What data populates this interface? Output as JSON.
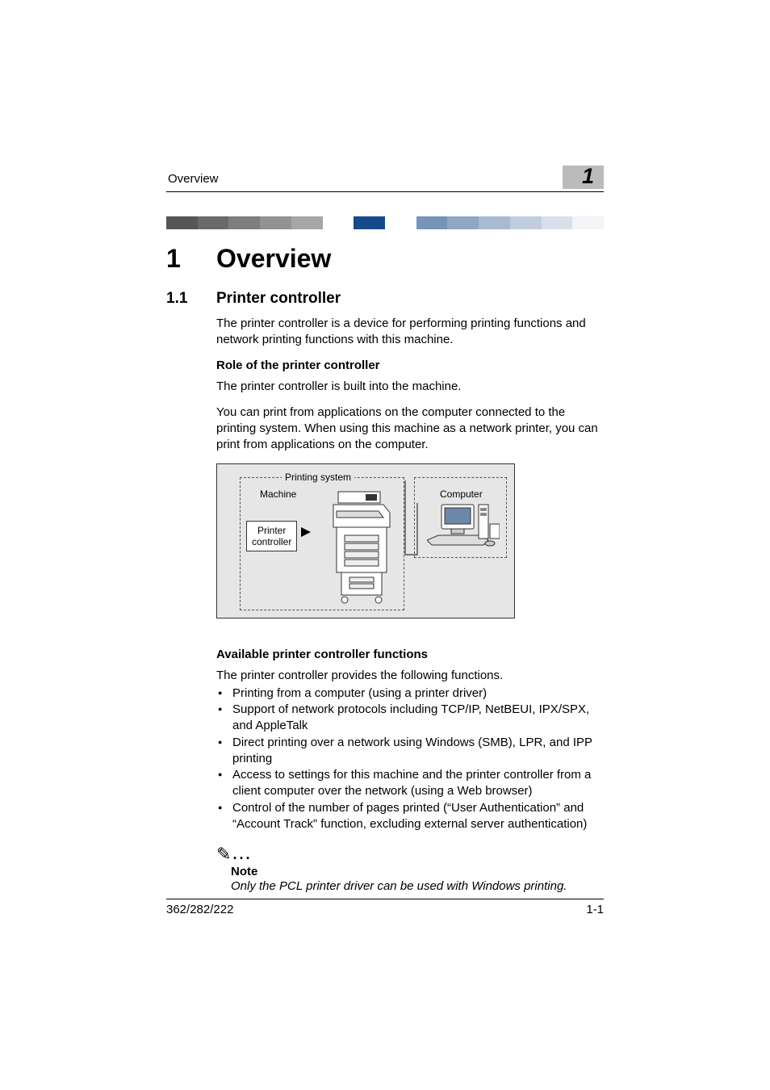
{
  "running_head": {
    "title": "Overview",
    "chapter_mark": "1"
  },
  "chapter": {
    "num": "1",
    "title": "Overview"
  },
  "section": {
    "num": "1.1",
    "title": "Printer controller"
  },
  "intro": "The printer controller is a device for performing printing functions and network printing functions with this machine.",
  "role": {
    "heading": "Role of the printer controller",
    "p1": "The printer controller is built into the machine.",
    "p2": "You can print from applications on the computer connected to the printing system. When using this machine as a network printer, you can print from applications on the computer."
  },
  "figure": {
    "printing_system": "Printing system",
    "machine": "Machine",
    "computer": "Computer",
    "printer_controller_l1": "Printer",
    "printer_controller_l2": "controller"
  },
  "functions": {
    "heading": "Available printer controller functions",
    "intro": "The printer controller provides the following functions.",
    "items": [
      "Printing from a computer (using a printer driver)",
      "Support of network protocols including TCP/IP, NetBEUI, IPX/SPX, and AppleTalk",
      "Direct printing over a network using Windows (SMB), LPR, and IPP printing",
      "Access to settings for this machine and the printer controller from a client computer over the network (using a Web browser)",
      "Control of the number of pages printed (“User Authentication” and “Account Track” function, excluding external server authentication)"
    ]
  },
  "note": {
    "label": "Note",
    "body": "Only the PCL printer driver can be used with Windows printing."
  },
  "footer": {
    "left": "362/282/222",
    "right": "1-1"
  }
}
